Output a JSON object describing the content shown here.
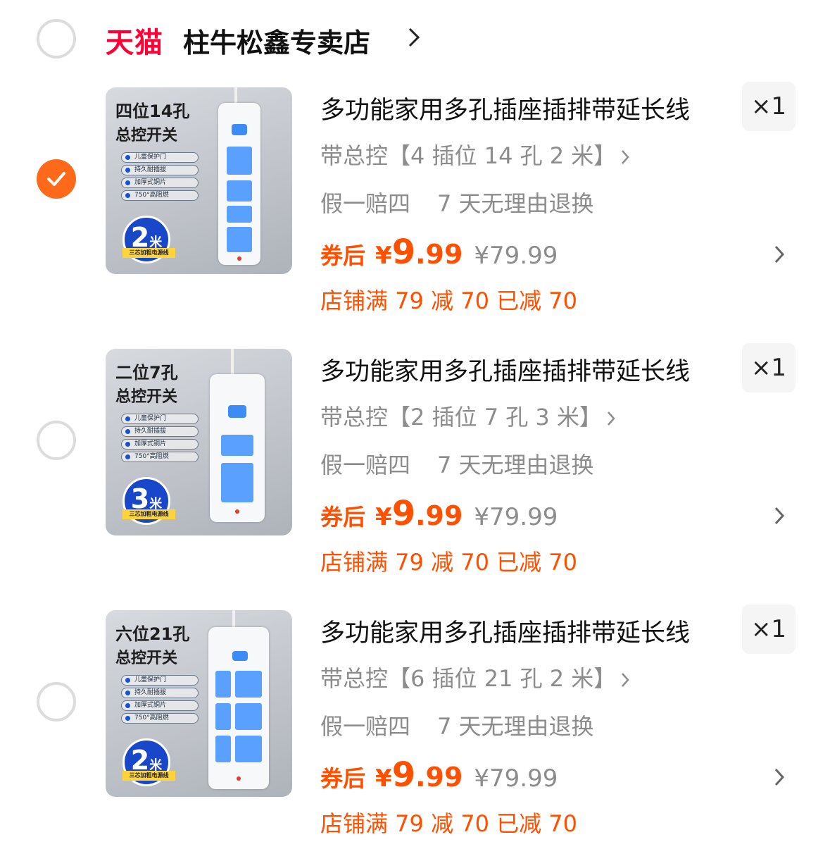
{
  "shop": {
    "platform": "天猫",
    "name": "柱牛松鑫专卖店"
  },
  "items": [
    {
      "selected": true,
      "thumb": {
        "title": "四位14孔",
        "subtitle": "总控开关",
        "features": [
          "儿童保护门",
          "持久耐插拔",
          "加厚式铜片",
          "750°高阻燃"
        ],
        "length_num": "2",
        "length_unit": "米",
        "cord_label": "三芯加粗电源线"
      },
      "title": "多功能家用多孔插座插排带延长线",
      "qty": "×1",
      "spec": "带总控【4 插位 14 孔 2 米】",
      "services": [
        "假一赔四",
        "7 天无理由退换"
      ],
      "price_after_label": "券后",
      "price_symbol": "¥",
      "price_int": "9",
      "price_dec": ".99",
      "original_price": "¥79.99",
      "promo": "店铺满 79 减 70 已减 70"
    },
    {
      "selected": false,
      "thumb": {
        "title": "二位7孔",
        "subtitle": "总控开关",
        "features": [
          "儿童保护门",
          "持久耐插拔",
          "加厚式铜片",
          "750°高阻燃"
        ],
        "length_num": "3",
        "length_unit": "米",
        "cord_label": "三芯加粗电源线"
      },
      "title": "多功能家用多孔插座插排带延长线",
      "qty": "×1",
      "spec": "带总控【2 插位 7 孔 3 米】",
      "services": [
        "假一赔四",
        "7 天无理由退换"
      ],
      "price_after_label": "券后",
      "price_symbol": "¥",
      "price_int": "9",
      "price_dec": ".99",
      "original_price": "¥79.99",
      "promo": "店铺满 79 减 70 已减 70"
    },
    {
      "selected": false,
      "thumb": {
        "title": "六位21孔",
        "subtitle": "总控开关",
        "features": [
          "儿童保护门",
          "持久耐插拔",
          "加厚式铜片",
          "750°高阻燃"
        ],
        "length_num": "2",
        "length_unit": "米",
        "cord_label": "三芯加粗电源线"
      },
      "title": "多功能家用多孔插座插排带延长线",
      "qty": "×1",
      "spec": "带总控【6 插位 21 孔 2 米】",
      "services": [
        "假一赔四",
        "7 天无理由退换"
      ],
      "price_after_label": "券后",
      "price_symbol": "¥",
      "price_int": "9",
      "price_dec": ".99",
      "original_price": "¥79.99",
      "promo": "店铺满 79 减 70 已减 70"
    }
  ],
  "colors": {
    "accent": "#ff5000",
    "check": "#ff6a1a",
    "tmall": "#ff0036",
    "muted": "#8c8c8c"
  }
}
